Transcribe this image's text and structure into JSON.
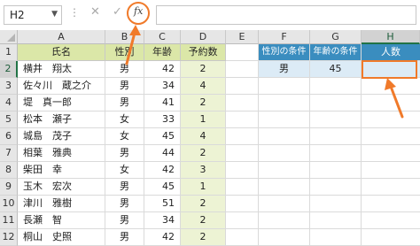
{
  "formula_bar": {
    "name_box": "H2",
    "dots": "⋮",
    "cancel_glyph": "✕",
    "enter_glyph": "✓",
    "fx_label": "fx",
    "formula": ""
  },
  "columns": [
    "A",
    "B",
    "C",
    "D",
    "E",
    "F",
    "G",
    "H"
  ],
  "rows": [
    "1",
    "2",
    "3",
    "4",
    "5",
    "6",
    "7",
    "8",
    "9",
    "10",
    "11",
    "12"
  ],
  "table": {
    "headers": [
      "氏名",
      "性別",
      "年齢",
      "予約数"
    ],
    "rows": [
      [
        "横井　翔太",
        "男",
        "42",
        "2"
      ],
      [
        "佐々川　蔵之介",
        "男",
        "34",
        "4"
      ],
      [
        "堤　真一郎",
        "男",
        "41",
        "2"
      ],
      [
        "松本　瀬子",
        "女",
        "33",
        "1"
      ],
      [
        "城島　茂子",
        "女",
        "45",
        "4"
      ],
      [
        "相葉　雅典",
        "男",
        "44",
        "2"
      ],
      [
        "柴田　幸",
        "女",
        "42",
        "3"
      ],
      [
        "玉木　宏次",
        "男",
        "45",
        "1"
      ],
      [
        "津川　雅樹",
        "男",
        "51",
        "2"
      ],
      [
        "長瀬　智",
        "男",
        "34",
        "2"
      ],
      [
        "桐山　史照",
        "男",
        "42",
        "2"
      ]
    ]
  },
  "conditions": {
    "headers": [
      "性別の条件",
      "年齢の条件",
      "人数"
    ],
    "values": [
      "男",
      "45",
      ""
    ]
  },
  "colors": {
    "accent_orange": "#f07a2a",
    "header_green": "#dbe7a8",
    "header_blue": "#3a8dbf"
  }
}
